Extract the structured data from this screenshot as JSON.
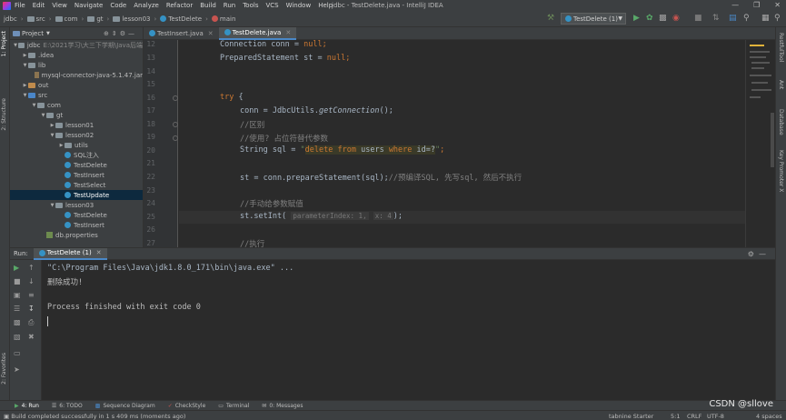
{
  "app": {
    "title": "jdbc - TestDelete.java - IntelliJ IDEA",
    "menu": [
      "File",
      "Edit",
      "View",
      "Navigate",
      "Code",
      "Analyze",
      "Refactor",
      "Build",
      "Run",
      "Tools",
      "VCS",
      "Window",
      "Help"
    ]
  },
  "navbar": {
    "breadcrumbs": [
      "jdbc",
      "src",
      "com",
      "gt",
      "lesson03",
      "TestDelete",
      "main"
    ],
    "run_config": "TestDelete (1)"
  },
  "left_strip": {
    "project": "1: Project",
    "structure": "2: Structure",
    "favorites": "2: Favorites"
  },
  "right_strip": {
    "retrofit": "RestfulTool",
    "ant": "Ant",
    "database": "Database",
    "maven": "Key Promoter X"
  },
  "project": {
    "header": "Project",
    "tree": [
      {
        "label": "jdbc",
        "hint": "E:\\2021学习\\大三下学期\\Java后端",
        "depth": 0,
        "icon": "folder",
        "open": true
      },
      {
        "label": ".idea",
        "depth": 1,
        "icon": "folder",
        "open": false
      },
      {
        "label": "lib",
        "depth": 1,
        "icon": "folder",
        "open": true
      },
      {
        "label": "mysql-connector-java-5.1.47.jar",
        "depth": 2,
        "icon": "jar",
        "open": false
      },
      {
        "label": "out",
        "depth": 1,
        "icon": "out",
        "open": false
      },
      {
        "label": "src",
        "depth": 1,
        "icon": "src",
        "open": true
      },
      {
        "label": "com",
        "depth": 2,
        "icon": "pkg",
        "open": true
      },
      {
        "label": "gt",
        "depth": 3,
        "icon": "pkg",
        "open": true
      },
      {
        "label": "lesson01",
        "depth": 4,
        "icon": "pkg",
        "open": false
      },
      {
        "label": "lesson02",
        "depth": 4,
        "icon": "pkg",
        "open": true
      },
      {
        "label": "utils",
        "depth": 5,
        "icon": "pkg",
        "open": false
      },
      {
        "label": "SQL注入",
        "depth": 5,
        "icon": "class",
        "open": false
      },
      {
        "label": "TestDelete",
        "depth": 5,
        "icon": "class",
        "open": false
      },
      {
        "label": "TestInsert",
        "depth": 5,
        "icon": "class",
        "open": false
      },
      {
        "label": "TestSelect",
        "depth": 5,
        "icon": "class",
        "open": false
      },
      {
        "label": "TestUpdate",
        "depth": 5,
        "icon": "class",
        "open": false,
        "selected": true
      },
      {
        "label": "lesson03",
        "depth": 4,
        "icon": "pkg",
        "open": true
      },
      {
        "label": "TestDelete",
        "depth": 5,
        "icon": "class",
        "open": false
      },
      {
        "label": "TestInsert",
        "depth": 5,
        "icon": "class",
        "open": false
      },
      {
        "label": "db.properties",
        "depth": 3,
        "icon": "props",
        "open": false
      }
    ]
  },
  "editor": {
    "tabs": [
      {
        "label": "TestInsert.java",
        "active": false
      },
      {
        "label": "TestDelete.java",
        "active": true
      }
    ],
    "line_numbers": [
      "12",
      "13",
      "14",
      "15",
      "16",
      "17",
      "18",
      "19",
      "20",
      "21",
      "22",
      "23",
      "24",
      "25",
      "26",
      "27"
    ],
    "code": {
      "l12": {
        "t1": "Connection",
        "t2": " conn = ",
        "t3": "null",
        "t4": ";"
      },
      "l13": {
        "t1": "PreparedStatement",
        "t2": " st = ",
        "t3": "null",
        "t4": ";"
      },
      "l16": {
        "t1": "try",
        "t2": " {"
      },
      "l17": {
        "t1": "conn = JdbcUtils.",
        "t2": "getConnection",
        "t3": "();"
      },
      "l18": {
        "t1": "//区别"
      },
      "l19": {
        "t1": "//使用? 占位符替代参数"
      },
      "l20": {
        "t1": "String sql = ",
        "t2": "\"",
        "t3": "delete",
        "t4": " ",
        "t5": "from",
        "t6": " users ",
        "t7": "where",
        "t8": " id=?",
        "t9": "\"",
        "t10": ";"
      },
      "l22": {
        "t1": "st = conn.prepareStatement(sql);",
        "t2": "//预编译SQL, 先写sql, 然后不执行"
      },
      "l24": {
        "t1": "//手动给参数赋值"
      },
      "l25": {
        "t1": "st.setInt(",
        "t2": "parameterIndex: 1,",
        "t3": "x: 4",
        "t4": ");"
      },
      "l27": {
        "t1": "//执行"
      }
    }
  },
  "run": {
    "label": "Run:",
    "tab": "TestDelete (1)",
    "console": [
      "\"C:\\Program Files\\Java\\jdk1.8.0_171\\bin\\java.exe\" ...",
      "删除成功!",
      "",
      "Process finished with exit code 0"
    ]
  },
  "bottom_tabs": [
    "4: Run",
    "6: TODO",
    "Sequence Diagram",
    "CheckStyle",
    "Terminal",
    "0: Messages"
  ],
  "status": {
    "message": "Build completed successfully in 1 s 409 ms (moments ago)",
    "tabnine": "tabnine Starter",
    "position": "5:1",
    "line_sep": "CRLF",
    "encoding": "UTF-8",
    "indent": "4 spaces"
  },
  "watermark": "CSDN @sllove"
}
